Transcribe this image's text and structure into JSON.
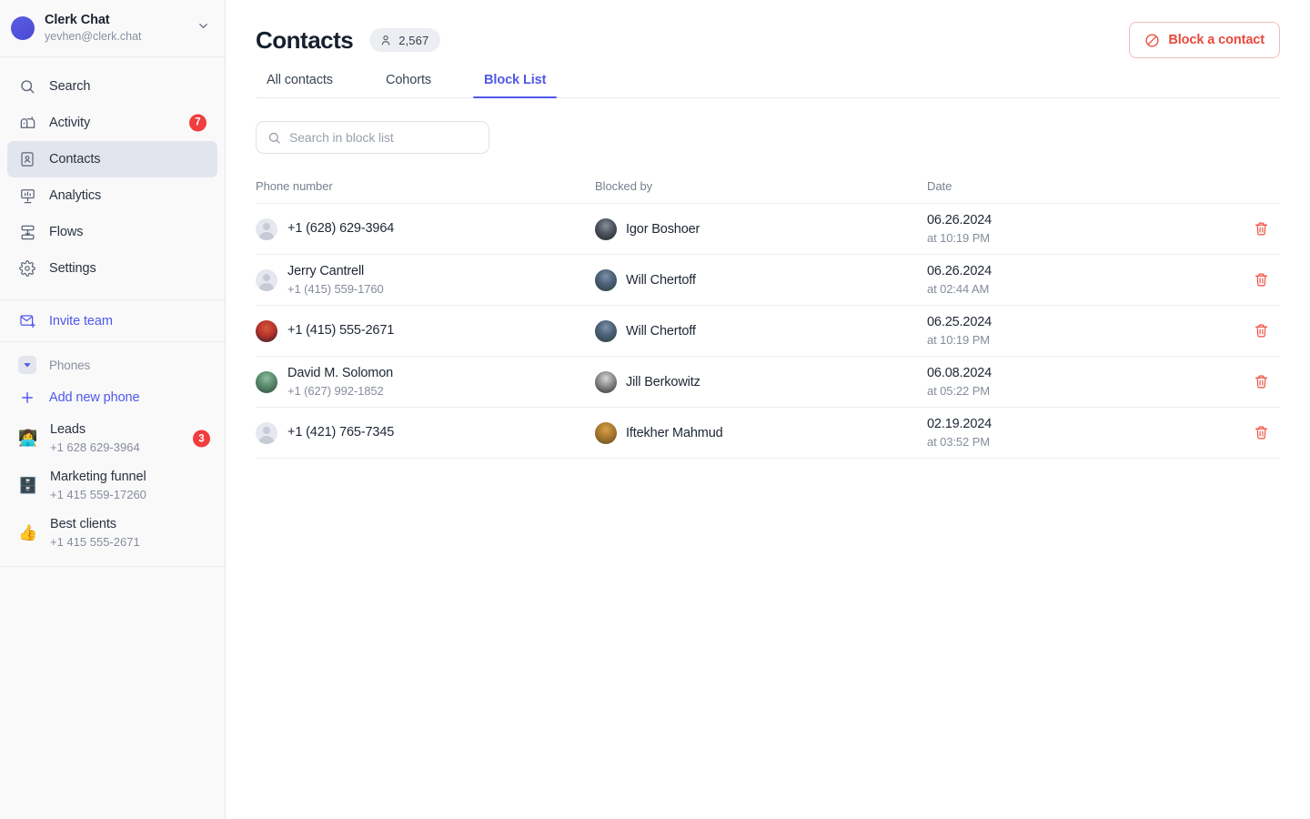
{
  "sidebar": {
    "account": {
      "logo_icon": "clerk-chat-logo",
      "name": "Clerk Chat",
      "email": "yevhen@clerk.chat",
      "chevron_icon": "chevron-down-icon"
    },
    "nav": [
      {
        "label": "Search",
        "icon": "search-icon",
        "badge": "",
        "active": false
      },
      {
        "label": "Activity",
        "icon": "mailbox-icon",
        "badge": "7",
        "active": false
      },
      {
        "label": "Contacts",
        "icon": "contact-card-icon",
        "badge": "",
        "active": true
      },
      {
        "label": "Analytics",
        "icon": "presentation-icon",
        "badge": "",
        "active": false
      },
      {
        "label": "Flows",
        "icon": "flow-icon",
        "badge": "",
        "active": false
      },
      {
        "label": "Settings",
        "icon": "gear-icon",
        "badge": "",
        "active": false
      }
    ],
    "invite": {
      "label": "Invite team",
      "icon": "envelope-plus-icon"
    },
    "phones_section": {
      "label": "Phones",
      "toggle_icon": "caret-down-icon",
      "add_label": "Add new phone",
      "add_icon": "plus-icon",
      "items": [
        {
          "emoji": "👩‍💻",
          "name": "Leads",
          "number": "+1 628 629-3964",
          "badge": "3"
        },
        {
          "emoji": "🗄️",
          "name": "Marketing funnel",
          "number": "+1 415 559-17260",
          "badge": ""
        },
        {
          "emoji": "👍",
          "name": "Best clients",
          "number": "+1 415 555-2671",
          "badge": ""
        }
      ]
    }
  },
  "header": {
    "title": "Contacts",
    "count_icon": "person-icon",
    "count": "2,567",
    "block_button": {
      "label": "Block a contact",
      "icon": "block-icon"
    }
  },
  "tabs": [
    {
      "label": "All contacts",
      "active": false
    },
    {
      "label": "Cohorts",
      "active": false
    },
    {
      "label": "Block List",
      "active": true
    }
  ],
  "search": {
    "icon": "search-icon",
    "placeholder": "Search in block list",
    "value": ""
  },
  "table": {
    "columns": [
      "Phone number",
      "Blocked by",
      "Date"
    ],
    "delete_icon": "trash-icon",
    "rows": [
      {
        "avatar": "placeholder",
        "primary": "+1 (628) 629-3964",
        "secondary": "",
        "blocked_by": "Igor Boshoer",
        "blocked_by_avatar": "av-c",
        "date": "06.26.2024",
        "time": "at 10:19 PM"
      },
      {
        "avatar": "placeholder",
        "primary": "Jerry Cantrell",
        "secondary": "+1 (415) 559-1760",
        "blocked_by": "Will Chertoff",
        "blocked_by_avatar": "av-d",
        "date": "06.26.2024",
        "time": "at 02:44 AM"
      },
      {
        "avatar": "av-a",
        "primary": "+1 (415) 555-2671",
        "secondary": "",
        "blocked_by": "Will Chertoff",
        "blocked_by_avatar": "av-d",
        "date": "06.25.2024",
        "time": "at 10:19 PM"
      },
      {
        "avatar": "av-b",
        "primary": "David M. Solomon",
        "secondary": "+1 (627) 992-1852",
        "blocked_by": "Jill Berkowitz",
        "blocked_by_avatar": "av-e",
        "date": "06.08.2024",
        "time": "at 05:22 PM"
      },
      {
        "avatar": "placeholder",
        "primary": "+1 (421) 765-7345",
        "secondary": "",
        "blocked_by": "Iftekher Mahmud",
        "blocked_by_avatar": "av-f",
        "date": "02.19.2024",
        "time": "at 03:52 PM"
      }
    ]
  },
  "colors": {
    "brand": "#4f58ea",
    "danger": "#ef4b3c",
    "badge": "#f03d3d",
    "sidebar_bg": "#f9f9fa",
    "active_nav_bg": "#e2e5ed"
  }
}
